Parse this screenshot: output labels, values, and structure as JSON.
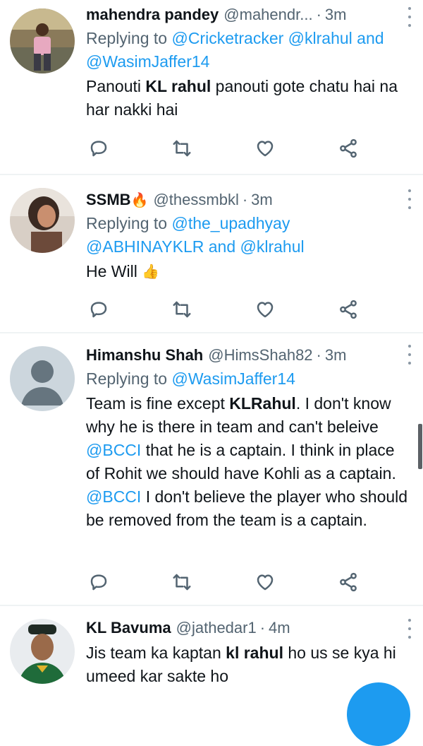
{
  "tweets": [
    {
      "name": "mahendra pandey",
      "handle": "@mahendr...",
      "dot": "·",
      "time": "3m",
      "replying_prefix": "Replying to",
      "replying_to": [
        "@Cricketracker",
        "@klrahul",
        "and",
        "@WasimJaffer14"
      ],
      "body": {
        "p1": "Panouti ",
        "b1": "KL rahul",
        "p2": " panouti gote chatu hai na har nakki hai"
      }
    },
    {
      "name": "SSMB",
      "name_emoji": "🔥",
      "handle": "@thessmbkl",
      "dot": "·",
      "time": "3m",
      "replying_prefix": "Replying to",
      "replying_to": [
        "@the_upadhyay",
        "@ABHINAYKLR",
        "and",
        "@klrahul"
      ],
      "body": {
        "p1": "He Will",
        "emoji": "👍"
      }
    },
    {
      "name": "Himanshu Shah",
      "handle": "@HimsShah82",
      "dot": "·",
      "time": "3m",
      "replying_prefix": "Replying to",
      "replying_to": [
        "@WasimJaffer14"
      ],
      "body": {
        "p1": "Team is fine except ",
        "b1": "KLRahul",
        "p2": ". I don't know why he is there in team and can't beleive ",
        "m1": "@BCCI",
        "p3": " that he is a captain. I think in place of Rohit we should have Kohli as a captain. ",
        "m2": "@BCCI",
        "p4": " I don't believe the player who should be removed from the team is a captain."
      }
    },
    {
      "name": "KL Bavuma",
      "handle": "@jathedar1",
      "dot": "·",
      "time": "4m",
      "body": {
        "p1": "Jis team ka kaptan ",
        "b1": "kl rahul",
        "p2": " ho us se kya hi umeed kar sakte ho"
      }
    }
  ],
  "icons": [
    "reply-icon",
    "retweet-icon",
    "like-icon",
    "share-icon",
    "more-icon"
  ],
  "colors": {
    "link": "#1d9bf0",
    "secondary": "#536471",
    "text": "#0f1419",
    "separator": "#eff3f4"
  }
}
